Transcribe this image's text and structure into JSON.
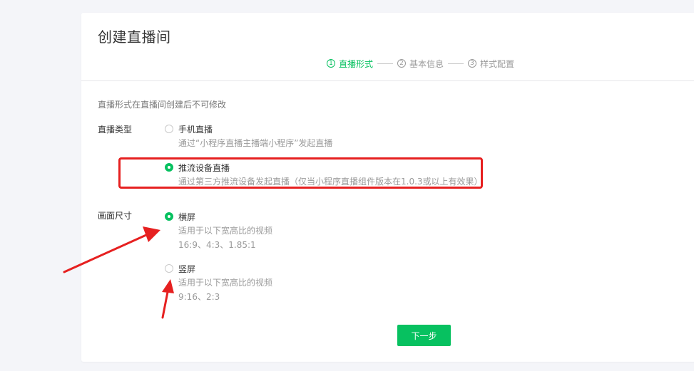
{
  "page": {
    "title": "创建直播间"
  },
  "steps": [
    {
      "num": "1",
      "label": "直播形式",
      "active": true
    },
    {
      "num": "2",
      "label": "基本信息",
      "active": false
    },
    {
      "num": "3",
      "label": "样式配置",
      "active": false
    }
  ],
  "hint": "直播形式在直播间创建后不可修改",
  "live_type": {
    "label": "直播类型",
    "options": [
      {
        "title": "手机直播",
        "desc": "通过“小程序直播主播端小程序”发起直播",
        "checked": false
      },
      {
        "title": "推流设备直播",
        "desc": "通过第三方推流设备发起直播（仅当小程序直播组件版本在1.0.3或以上有效果）",
        "checked": true
      }
    ]
  },
  "screen_size": {
    "label": "画面尺寸",
    "options": [
      {
        "title": "横屏",
        "desc": "适用于以下宽高比的视频",
        "ratios": "16:9、4:3、1.85:1",
        "checked": true
      },
      {
        "title": "竖屏",
        "desc": "适用于以下宽高比的视频",
        "ratios": "9:16、2:3",
        "checked": false
      }
    ]
  },
  "next_button": "下一步",
  "colors": {
    "accent": "#07c160",
    "annotation": "#e62020"
  }
}
